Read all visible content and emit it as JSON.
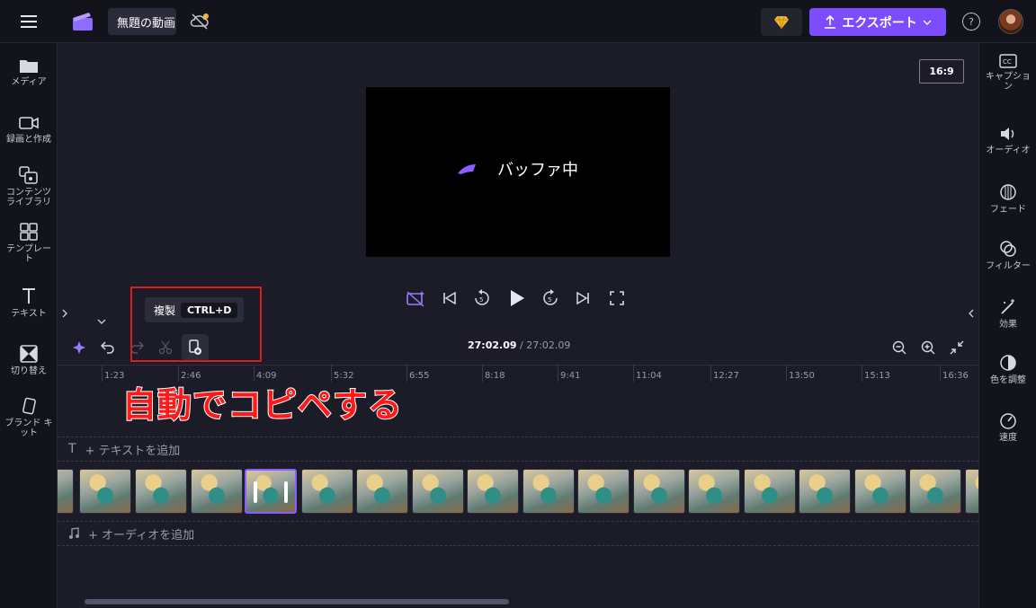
{
  "header": {
    "project_title": "無題の動画",
    "export_label": "エクスポート",
    "help_label": "?"
  },
  "left_sidebar": {
    "items": [
      {
        "label": "メディア",
        "icon": "folder-icon"
      },
      {
        "label": "録画と作成",
        "icon": "camera-icon"
      },
      {
        "label": "コンテンツ\nライブラリ",
        "icon": "library-icon"
      },
      {
        "label": "テンプレー\nト",
        "icon": "template-icon"
      },
      {
        "label": "テキスト",
        "icon": "text-icon"
      },
      {
        "label": "切り替え",
        "icon": "transition-icon"
      },
      {
        "label": "ブランド キ\nット",
        "icon": "brand-kit-icon"
      }
    ]
  },
  "right_sidebar": {
    "items": [
      {
        "label": "キャプショ\nン",
        "icon": "captions-icon"
      },
      {
        "label": "オーディオ",
        "icon": "audio-icon"
      },
      {
        "label": "フェード",
        "icon": "fade-icon"
      },
      {
        "label": "フィルター",
        "icon": "filter-icon"
      },
      {
        "label": "効果",
        "icon": "effects-icon"
      },
      {
        "label": "色を調整",
        "icon": "color-adjust-icon"
      },
      {
        "label": "速度",
        "icon": "speed-icon"
      }
    ]
  },
  "preview": {
    "aspect_ratio": "16:9",
    "buffer_text": "バッファ中"
  },
  "tooltip": {
    "label": "複製",
    "shortcut": "CTRL+D"
  },
  "timeline": {
    "current_time": "27:02.09",
    "total_time": "/ 27:02.09",
    "ruler_ticks": [
      "1:23",
      "2:46",
      "4:09",
      "5:32",
      "6:55",
      "8:18",
      "9:41",
      "11:04",
      "12:27",
      "13:50",
      "15:13",
      "16:36"
    ],
    "add_text_label": "+ テキストを追加",
    "add_audio_label": "+ オーディオを追加"
  },
  "annotation": {
    "text": "自動でコピペする",
    "color": "#ff1a1a"
  },
  "colors": {
    "accent": "#7c4dff",
    "highlight_box": "#e01b1b"
  }
}
